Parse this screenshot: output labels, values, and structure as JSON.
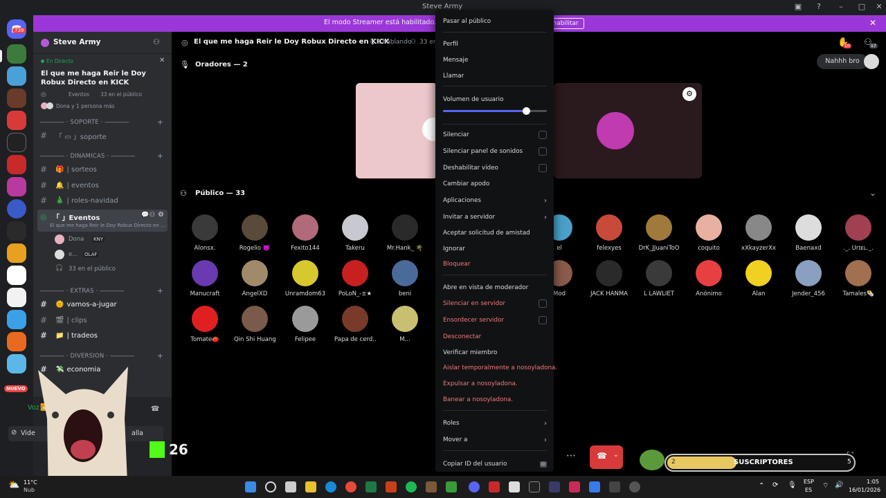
{
  "window": {
    "title": "Steve Army"
  },
  "banner": {
    "text": "El modo Streamer está habilitado. Los n",
    "button": "habilitar"
  },
  "rail": {
    "badge_top": "739",
    "badge_new": "NUEVO"
  },
  "sidebar": {
    "server_name": "Steve Army",
    "live_label": "En Directo",
    "live_title": "El que me haga Reir le Doy Robux Directo en KICK",
    "live_meta": "Eventos",
    "live_audience": "33 en el público",
    "live_people": "Dona y 1 persona más",
    "cat_soporte": "―――― · SOPORTE · ――――",
    "ch_soporte": "「 ▭ 」soporte",
    "cat_dinamicas": "―――― · DINAMICAS · ――――",
    "ch_sorteos": "| sorteos",
    "ch_eventos": "| eventos",
    "ch_roles": "| roles-navidad",
    "ch_stage": "「 」Eventos",
    "ch_stage_sub": "El que me haga Reir le Doy Robux Directo en ...",
    "stage_user1": "Dona",
    "stage_user1_tag": "KNY",
    "stage_user2": "e...",
    "stage_user2_tag": "OLAF",
    "stage_public": "33 en el público",
    "cat_extras": "―――― · EXTRAS · ――――",
    "ch_vamos": "vamos-a-jugar",
    "ch_clips": "| clips",
    "ch_tradeos": "| tradeos",
    "cat_diversion": "―――― · DIVERSION · ――――",
    "ch_economia": "economia",
    "voice_label": "Voz co",
    "video_btn": "Vide",
    "screen_btn": "alla",
    "counter": "26"
  },
  "main": {
    "title": "El que me haga Reir le Doy Robux Directo en KICK",
    "speaking": "2 hablando",
    "audience": "33 en",
    "speakers_label": "Oradores — 2",
    "public_label": "Público — 33",
    "chat_bubble": "Nahhh bro",
    "notif_count": "10",
    "sub_count": "17",
    "subs_left": "2",
    "subs_label": "SUSCRIPTORES",
    "subs_right": "5",
    "members": [
      {
        "name": "Alonsx.",
        "color": "#3a3a3a"
      },
      {
        "name": "Rogelio 👿",
        "color": "#5a4a3a"
      },
      {
        "name": "Fexito144",
        "color": "#b06a7a"
      },
      {
        "name": "Takeru",
        "color": "#c8c8d0"
      },
      {
        "name": "Mr.Hank_ 🌴",
        "color": "#2a2a2a"
      },
      {
        "name": "el",
        "color": "#4aa0c8"
      },
      {
        "name": "felexyes",
        "color": "#c84a3a"
      },
      {
        "name": "DrK_JJuaniToO",
        "color": "#a07a3a"
      },
      {
        "name": "coquito",
        "color": "#e8b0a0"
      },
      {
        "name": "xXkayzerXx",
        "color": "#888"
      },
      {
        "name": "Baenaxd",
        "color": "#ddd"
      },
      {
        "name": "._. Urɪᴇʟ._.",
        "color": "#a04050"
      },
      {
        "name": "Manucraft",
        "color": "#6a3ab0"
      },
      {
        "name": "ÁngelXD",
        "color": "#a08a6a"
      },
      {
        "name": "Unramdom63",
        "color": "#d8c830"
      },
      {
        "name": "PoLoN_-±★",
        "color": "#c82020"
      },
      {
        "name": "beni",
        "color": "#4a6a9a"
      },
      {
        "name": "Mod",
        "color": "#8a5a4a"
      },
      {
        "name": "JACK HANMA",
        "color": "#2a2a2a"
      },
      {
        "name": "L LAWLIET",
        "color": "#3a3a3a"
      },
      {
        "name": "Anónimo",
        "color": "#e84040"
      },
      {
        "name": "Alan",
        "color": "#f0d020"
      },
      {
        "name": "Jender_456",
        "color": "#8aa0c0"
      },
      {
        "name": "Tamales🌯",
        "color": "#a07050"
      },
      {
        "name": "Tomate🍅",
        "color": "#e02020"
      },
      {
        "name": "Qin Shi Huang",
        "color": "#7a5a4a"
      },
      {
        "name": "Felipee",
        "color": "#9a9a9a"
      },
      {
        "name": "Papa de cerd...",
        "color": "#7a3a2a"
      },
      {
        "name": "M...",
        "color": "#c8c070"
      }
    ]
  },
  "menu": {
    "pasar": "Pasar al público",
    "perfil": "Perfil",
    "mensaje": "Mensaje",
    "llamar": "Llamar",
    "volumen": "Volumen de usuario",
    "volume_level": 0.8,
    "silenciar": "Silenciar",
    "silenciar_panel": "Silenciar panel de sonidos",
    "deshabilitar": "Deshabilitar vídeo",
    "apodo": "Cambiar apodo",
    "aplicaciones": "Aplicaciones",
    "invitar": "Invitar a servidor",
    "aceptar": "Aceptar solicitud de amistad",
    "ignorar": "Ignorar",
    "bloquear": "Bloquear",
    "moderador": "Abre en vista de moderador",
    "silenciar_srv": "Silenciar en servidor",
    "ensordecer": "Ensordecer servidor",
    "desconectar": "Desconectar",
    "verificar": "Verificar miembro",
    "aislar": "Aislar temporalmente a nosoyladona.",
    "expulsar": "Expulsar a nosoyladona.",
    "banear": "Banear a nosoyladona.",
    "roles": "Roles",
    "mover": "Mover a",
    "copiar": "Copiar ID del usuario"
  },
  "taskbar": {
    "temp": "11°C",
    "weather": "Nub",
    "lang1": "ESP",
    "lang2": "ES",
    "time": "1:05",
    "date": "16/01/2026"
  }
}
